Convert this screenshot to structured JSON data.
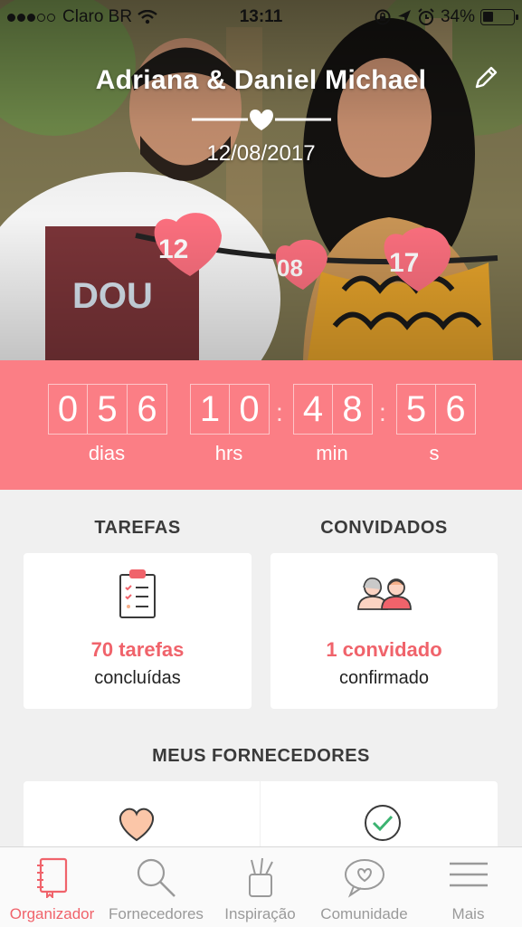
{
  "status_bar": {
    "carrier": "Claro BR",
    "time": "13:11",
    "battery": "34%",
    "battery_level": 0.34
  },
  "header": {
    "couple_names": "Adriana & Daniel Michael",
    "wedding_date": "12/08/2017",
    "photo_sign_labels": [
      "12",
      "08",
      "17"
    ]
  },
  "countdown": {
    "days": [
      "0",
      "5",
      "6"
    ],
    "hours": [
      "1",
      "0"
    ],
    "minutes": [
      "4",
      "8"
    ],
    "seconds": [
      "5",
      "6"
    ],
    "days_label": "dias",
    "hours_label": "hrs",
    "minutes_label": "min",
    "seconds_label": "s",
    "colors": {
      "background": "#fb7e85"
    }
  },
  "tasks": {
    "title": "TAREFAS",
    "count": "70 tarefas",
    "status": "concluídas",
    "icon": "clipboard-checklist-icon"
  },
  "guests": {
    "title": "CONVIDADOS",
    "count": "1 convidado",
    "status": "confirmado",
    "icon": "couple-avatars-icon"
  },
  "vendors": {
    "title": "MEUS FORNECEDORES",
    "icons": [
      "heart-icon",
      "checkmark-circle-icon"
    ]
  },
  "tab_bar": {
    "tabs": [
      {
        "label": "Organizador",
        "icon": "notebook-icon",
        "active": true
      },
      {
        "label": "Fornecedores",
        "icon": "search-icon",
        "active": false
      },
      {
        "label": "Inspiração",
        "icon": "pencil-cup-icon",
        "active": false
      },
      {
        "label": "Comunidade",
        "icon": "chat-heart-icon",
        "active": false
      },
      {
        "label": "Mais",
        "icon": "menu-icon",
        "active": false
      }
    ],
    "colors": {
      "active": "#f0636b",
      "inactive": "#9a9a9a"
    }
  }
}
